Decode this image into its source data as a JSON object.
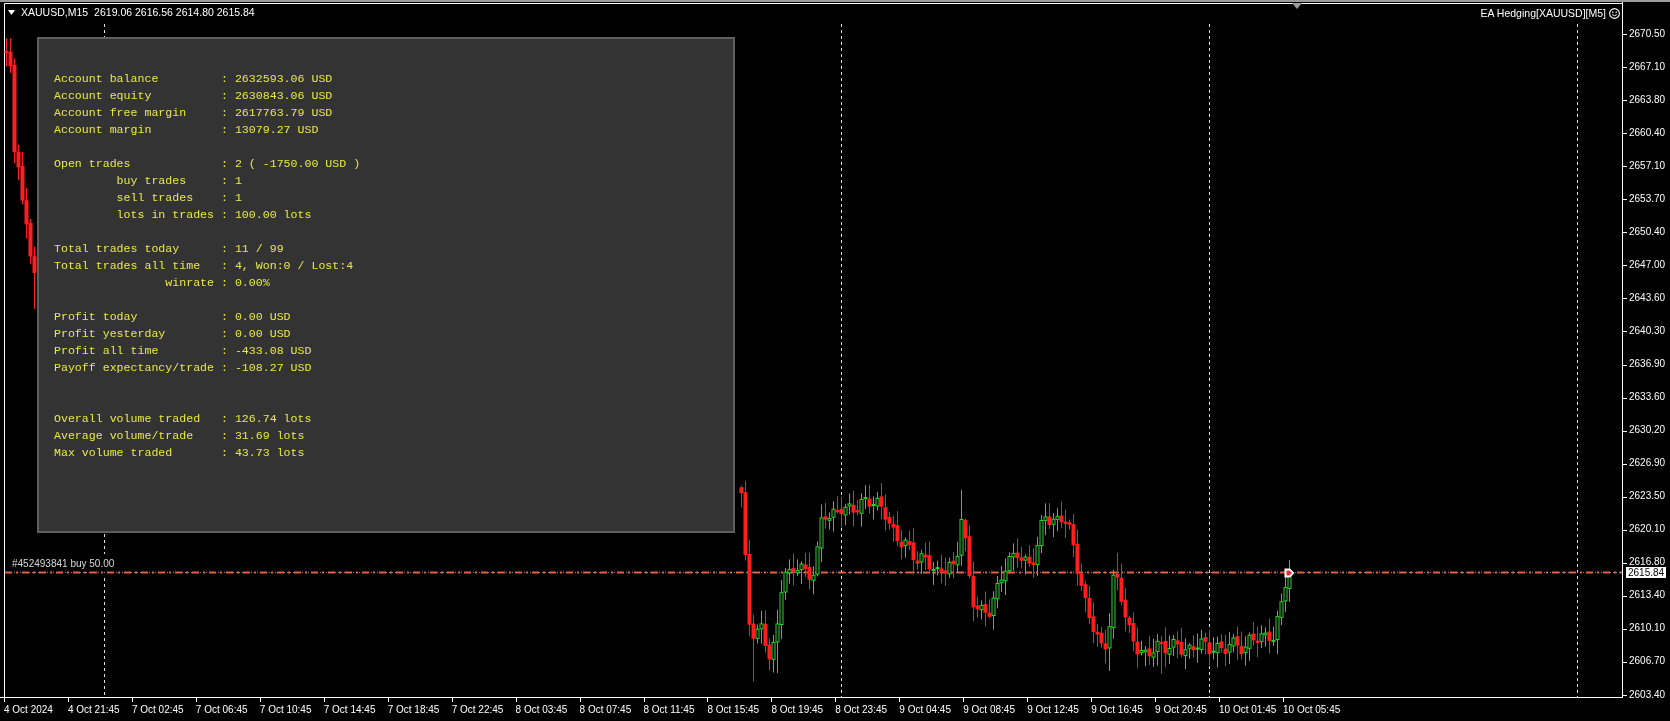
{
  "chart_header": {
    "symbol": "XAUUSD,M15",
    "quote": "2619.06 2616.56 2614.80 2615.84"
  },
  "expert_label": {
    "text": "EA Hedging[XAUUSD][M5]"
  },
  "stats_panel": {
    "groups": [
      {
        "kind": "section",
        "lines": [
          {
            "kind": "main",
            "text": "Account balance         : 2632593.06 USD"
          },
          {
            "kind": "main",
            "text": "Account equity          : 2630843.06 USD"
          },
          {
            "kind": "main",
            "text": "Account free margin     : 2617763.79 USD"
          },
          {
            "kind": "main",
            "text": "Account margin          : 13079.27 USD"
          }
        ]
      },
      {
        "kind": "section",
        "lines": [
          {
            "kind": "main",
            "text": "Open trades             : 2 ( -1750.00 USD )"
          },
          {
            "kind": "sub",
            "text": "buy trades     : 1"
          },
          {
            "kind": "sub",
            "text": "sell trades    : 1"
          },
          {
            "kind": "sub",
            "text": "lots in trades : 100.00 lots"
          }
        ]
      },
      {
        "kind": "section",
        "lines": [
          {
            "kind": "main",
            "text": "Total trades today      : 11 / 99"
          },
          {
            "kind": "main",
            "text": "Total trades all time   : 4, Won:0 / Lost:4"
          },
          {
            "kind": "deep",
            "text": "winrate : 0.00%"
          }
        ]
      },
      {
        "kind": "section",
        "lines": [
          {
            "kind": "main",
            "text": "Profit today            : 0.00 USD"
          },
          {
            "kind": "main",
            "text": "Profit yesterday        : 0.00 USD"
          },
          {
            "kind": "main",
            "text": "Profit all time         : -433.08 USD"
          },
          {
            "kind": "main",
            "text": "Payoff expectancy/trade : -108.27 USD"
          }
        ]
      },
      {
        "kind": "spaced",
        "lines": [
          {
            "kind": "main",
            "text": "Overall volume traded   : 126.74 lots"
          },
          {
            "kind": "main",
            "text": "Average volume/trade    : 31.69 lots"
          },
          {
            "kind": "main",
            "text": "Max volume traded       : 43.73 lots"
          }
        ]
      }
    ]
  },
  "order_labels": [
    {
      "text": "#452493841 buy 50.00"
    }
  ],
  "price_axis": {
    "ticks": [
      "2670.50",
      "2667.10",
      "2663.80",
      "2660.40",
      "2657.10",
      "2653.70",
      "2650.40",
      "2647.00",
      "2643.60",
      "2640.30",
      "2636.90",
      "2633.60",
      "2630.20",
      "2626.90",
      "2623.50",
      "2620.10",
      "2616.80",
      "2613.40",
      "2610.10",
      "2606.70",
      "2603.40"
    ],
    "current_price": "2615.84"
  },
  "time_axis": {
    "labels": [
      "4 Oct 2024",
      "4 Oct 21:45",
      "7 Oct 02:45",
      "7 Oct 06:45",
      "7 Oct 10:45",
      "7 Oct 14:45",
      "7 Oct 18:45",
      "7 Oct 22:45",
      "8 Oct 03:45",
      "8 Oct 07:45",
      "8 Oct 11:45",
      "8 Oct 15:45",
      "8 Oct 19:45",
      "8 Oct 23:45",
      "9 Oct 04:45",
      "9 Oct 08:45",
      "9 Oct 12:45",
      "9 Oct 16:45",
      "9 Oct 20:45",
      "10 Oct 01:45",
      "10 Oct 05:45"
    ]
  }
}
